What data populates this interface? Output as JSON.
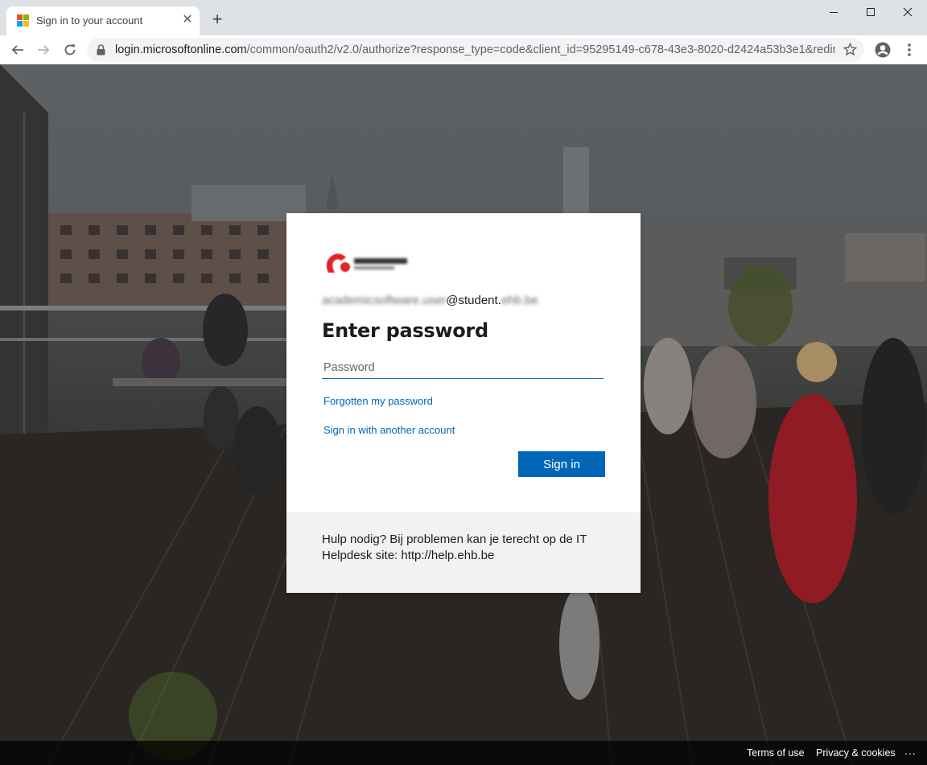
{
  "browser": {
    "tab_title": "Sign in to your account",
    "url_host": "login.microsoftonline.com",
    "url_path": "/common/oauth2/v2.0/authorize?response_type=code&client_id=95295149-c678-43e3-8020-d2424a53b3e1&redire..."
  },
  "icons": {
    "favicon": "microsoft-logo-icon",
    "tab_close": "close-icon",
    "new_tab": "plus-icon",
    "back": "back-arrow-icon",
    "forward": "forward-arrow-icon",
    "reload": "reload-icon",
    "lock": "lock-icon",
    "bookmark": "star-icon",
    "profile": "account-icon",
    "menu": "more-vertical-icon"
  },
  "signin": {
    "username_blurred": "academicsoftware.user",
    "username_domain_prefix": "@student.",
    "username_domain_blurred": "ehb.be",
    "title": "Enter password",
    "password_placeholder": "Password",
    "forgot_link": "Forgotten my password",
    "other_account_link": "Sign in with another account",
    "submit_label": "Sign in",
    "help_text": "Hulp nodig? Bij problemen kan je terecht op de IT Helpdesk site: http://help.ehb.be"
  },
  "footer": {
    "terms": "Terms of use",
    "privacy": "Privacy & cookies",
    "more": "..."
  },
  "colors": {
    "accent": "#0067b8",
    "logo_red": "#e2232a"
  }
}
